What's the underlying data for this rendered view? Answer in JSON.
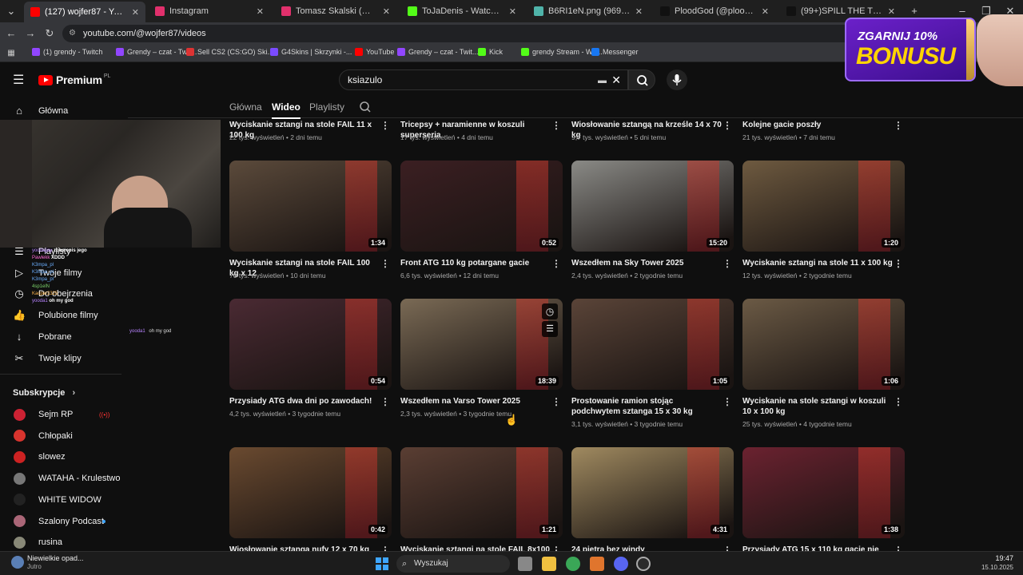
{
  "browser": {
    "tabs": [
      {
        "title": "(127) wojfer87 - YouTube",
        "color": "#ff0000",
        "active": true
      },
      {
        "title": "Instagram",
        "color": "#e1306c"
      },
      {
        "title": "Tomasz Skalski (@montecasyo)",
        "color": "#e1306c"
      },
      {
        "title": "ToJaDenis - Watch clips on Kick",
        "color": "#53fc18"
      },
      {
        "title": "B6RI1eN.png (969×942)",
        "color": "#4fb3a9"
      },
      {
        "title": "PloodGod (@ploodgod) | TikTok",
        "color": "#111111"
      },
      {
        "title": "(99+)SPILL THE TEA (@club.spill",
        "color": "#111111"
      }
    ],
    "new_tab": "+",
    "url": "youtube.com/@wojfer87/videos",
    "bookmarks": [
      {
        "label": "(1) grendy - Twitch",
        "color": "#9146ff"
      },
      {
        "label": "Grendy – czat - Twit...",
        "color": "#9146ff"
      },
      {
        "label": "Sell CS2 (CS:GO) Ski...",
        "color": "#d33"
      },
      {
        "label": "G4Skins | Skrzynki -...",
        "color": "#7a4bff"
      },
      {
        "label": "YouTube",
        "color": "#ff0000"
      },
      {
        "label": "Grendy – czat - Twit...",
        "color": "#9146ff"
      },
      {
        "label": "Kick",
        "color": "#53fc18"
      },
      {
        "label": "grendy Stream - Wa...",
        "color": "#53fc18"
      },
      {
        "label": "Messenger",
        "color": "#1877f2"
      }
    ]
  },
  "header": {
    "logo": "Premium",
    "logo_region": "PL",
    "search_value": "ksiazulo"
  },
  "promo": {
    "line1": "ZGARNIJ 10%",
    "line2": "BONUSU"
  },
  "channel_tabs": [
    "Główna",
    "Wideo",
    "Playlisty"
  ],
  "sidebar": {
    "home": "Główna",
    "items": [
      {
        "label": "Playlisty",
        "icon": "playlist-icon"
      },
      {
        "label": "Twoje filmy",
        "icon": "video-icon"
      },
      {
        "label": "Do obejrzenia",
        "icon": "clock-icon"
      },
      {
        "label": "Polubione filmy",
        "icon": "thumb-up-icon"
      },
      {
        "label": "Pobrane",
        "icon": "download-icon"
      },
      {
        "label": "Twoje klipy",
        "icon": "scissors-icon"
      }
    ],
    "subs_heading": "Subskrypcje",
    "subs": [
      {
        "label": "Sejm RP",
        "color": "#cc2233",
        "live": "((•))"
      },
      {
        "label": "Chłopaki",
        "color": "#d8342e"
      },
      {
        "label": "slowez",
        "color": "#c22"
      },
      {
        "label": "WATAHA - Krulestwo",
        "color": "#777"
      },
      {
        "label": "WHITE WIDOW",
        "color": "#222"
      },
      {
        "label": "Szalony Podcast",
        "color": "#a67"
      },
      {
        "label": "rusina",
        "color": "#887"
      }
    ]
  },
  "chat": [
    {
      "user": "yoodajjay",
      "msg": "zoba opis jego",
      "color": "#b884ff"
    },
    {
      "user": "Pawlekk",
      "msg": "XDDD",
      "color": "#ff6bd6"
    },
    {
      "user": "K3mpa_pl",
      "msg": "",
      "color": "#6bafff"
    },
    {
      "user": "K3mpa_pl",
      "msg": "",
      "color": "#6bafff"
    },
    {
      "user": "K3mpa_pl",
      "msg": "",
      "color": "#6bafff"
    },
    {
      "user": "4sp1elN",
      "msg": "",
      "color": "#7bd36b"
    },
    {
      "user": "Kacper2325",
      "msg": "",
      "color": "#ffb74d"
    },
    {
      "user": "yooda1",
      "msg": "oh my god",
      "color": "#b884ff"
    }
  ],
  "chat_float": {
    "user": "yooda1",
    "msg": "oh my god"
  },
  "videos": [
    {
      "title": "Wyciskanie sztangi na stole FAIL 11 x 100 kg",
      "meta": "22 tys. wyświetleń • 2 dni temu",
      "dur": "",
      "bg": "#4a3a2e"
    },
    {
      "title": "Tricepsy + naramienne w koszuli superseria",
      "meta": "17 tys. wyświetleń • 4 dni temu",
      "dur": "",
      "bg": "#3a2a2a"
    },
    {
      "title": "Wiosłowanie sztangą na krześle 14 x 70 kg",
      "meta": "9,7 tys. wyświetleń • 5 dni temu",
      "dur": "",
      "bg": "#555"
    },
    {
      "title": "Kolejne gacie poszły",
      "meta": "21 tys. wyświetleń • 7 dni temu",
      "dur": "",
      "bg": "#443"
    },
    {
      "title": "Wyciskanie sztangi na stole FAIL 100 kg x 12",
      "meta": "70 tys. wyświetleń • 10 dni temu",
      "dur": "1:34",
      "bg": "#5b4a3b"
    },
    {
      "title": "Front ATG 110 kg potargane gacie",
      "meta": "6,6 tys. wyświetleń • 12 dni temu",
      "dur": "0:52",
      "bg": "#3b1f22"
    },
    {
      "title": "Wszedłem na Sky Tower 2025",
      "meta": "2,4 tys. wyświetleń • 2 tygodnie temu",
      "dur": "15:20",
      "bg": "#8a8a86"
    },
    {
      "title": "Wyciskanie sztangi na stole 11 x 100 kg",
      "meta": "12 tys. wyświetleń • 2 tygodnie temu",
      "dur": "1:20",
      "bg": "#6e5a40"
    },
    {
      "title": "Przysiady ATG dwa dni po zawodach!",
      "meta": "4,2 tys. wyświetleń • 3 tygodnie temu",
      "dur": "0:54",
      "bg": "#4a2a33"
    },
    {
      "title": "Wszedłem na Varso Tower 2025",
      "meta": "2,3 tys. wyświetleń • 3 tygodnie temu",
      "dur": "18:39",
      "bg": "#7a6a55"
    },
    {
      "title": "Prostowanie ramion stojąc podchwytem sztanga 15 x 30 kg",
      "meta": "3,1 tys. wyświetleń • 3 tygodnie temu",
      "dur": "1:05",
      "bg": "#5a4438"
    },
    {
      "title": "Wyciskanie na stole sztangi w koszuli 10 x 100 kg",
      "meta": "25 tys. wyświetleń • 4 tygodnie temu",
      "dur": "1:06",
      "bg": "#6b5a45"
    },
    {
      "title": "Wiosłowanie sztanga nufy 12 x 70 kg",
      "meta": "",
      "dur": "0:42",
      "bg": "#6a4a30"
    },
    {
      "title": "Wyciskanie sztangi na stole FAIL 8x100 kg",
      "meta": "",
      "dur": "1:21",
      "bg": "#5a3e33"
    },
    {
      "title": "24 piętra bez windy",
      "meta": "",
      "dur": "4:31",
      "bg": "#a08a60"
    },
    {
      "title": "Przysiady ATG 15 x 110 kg gacie nie",
      "meta": "",
      "dur": "1:38",
      "bg": "#6b2230"
    }
  ],
  "taskbar": {
    "weather_title": "Niewielkie opad...",
    "weather_sub": "Jutro",
    "search": "Wyszukaj",
    "time": "19:47",
    "date": "15.10.2025"
  }
}
